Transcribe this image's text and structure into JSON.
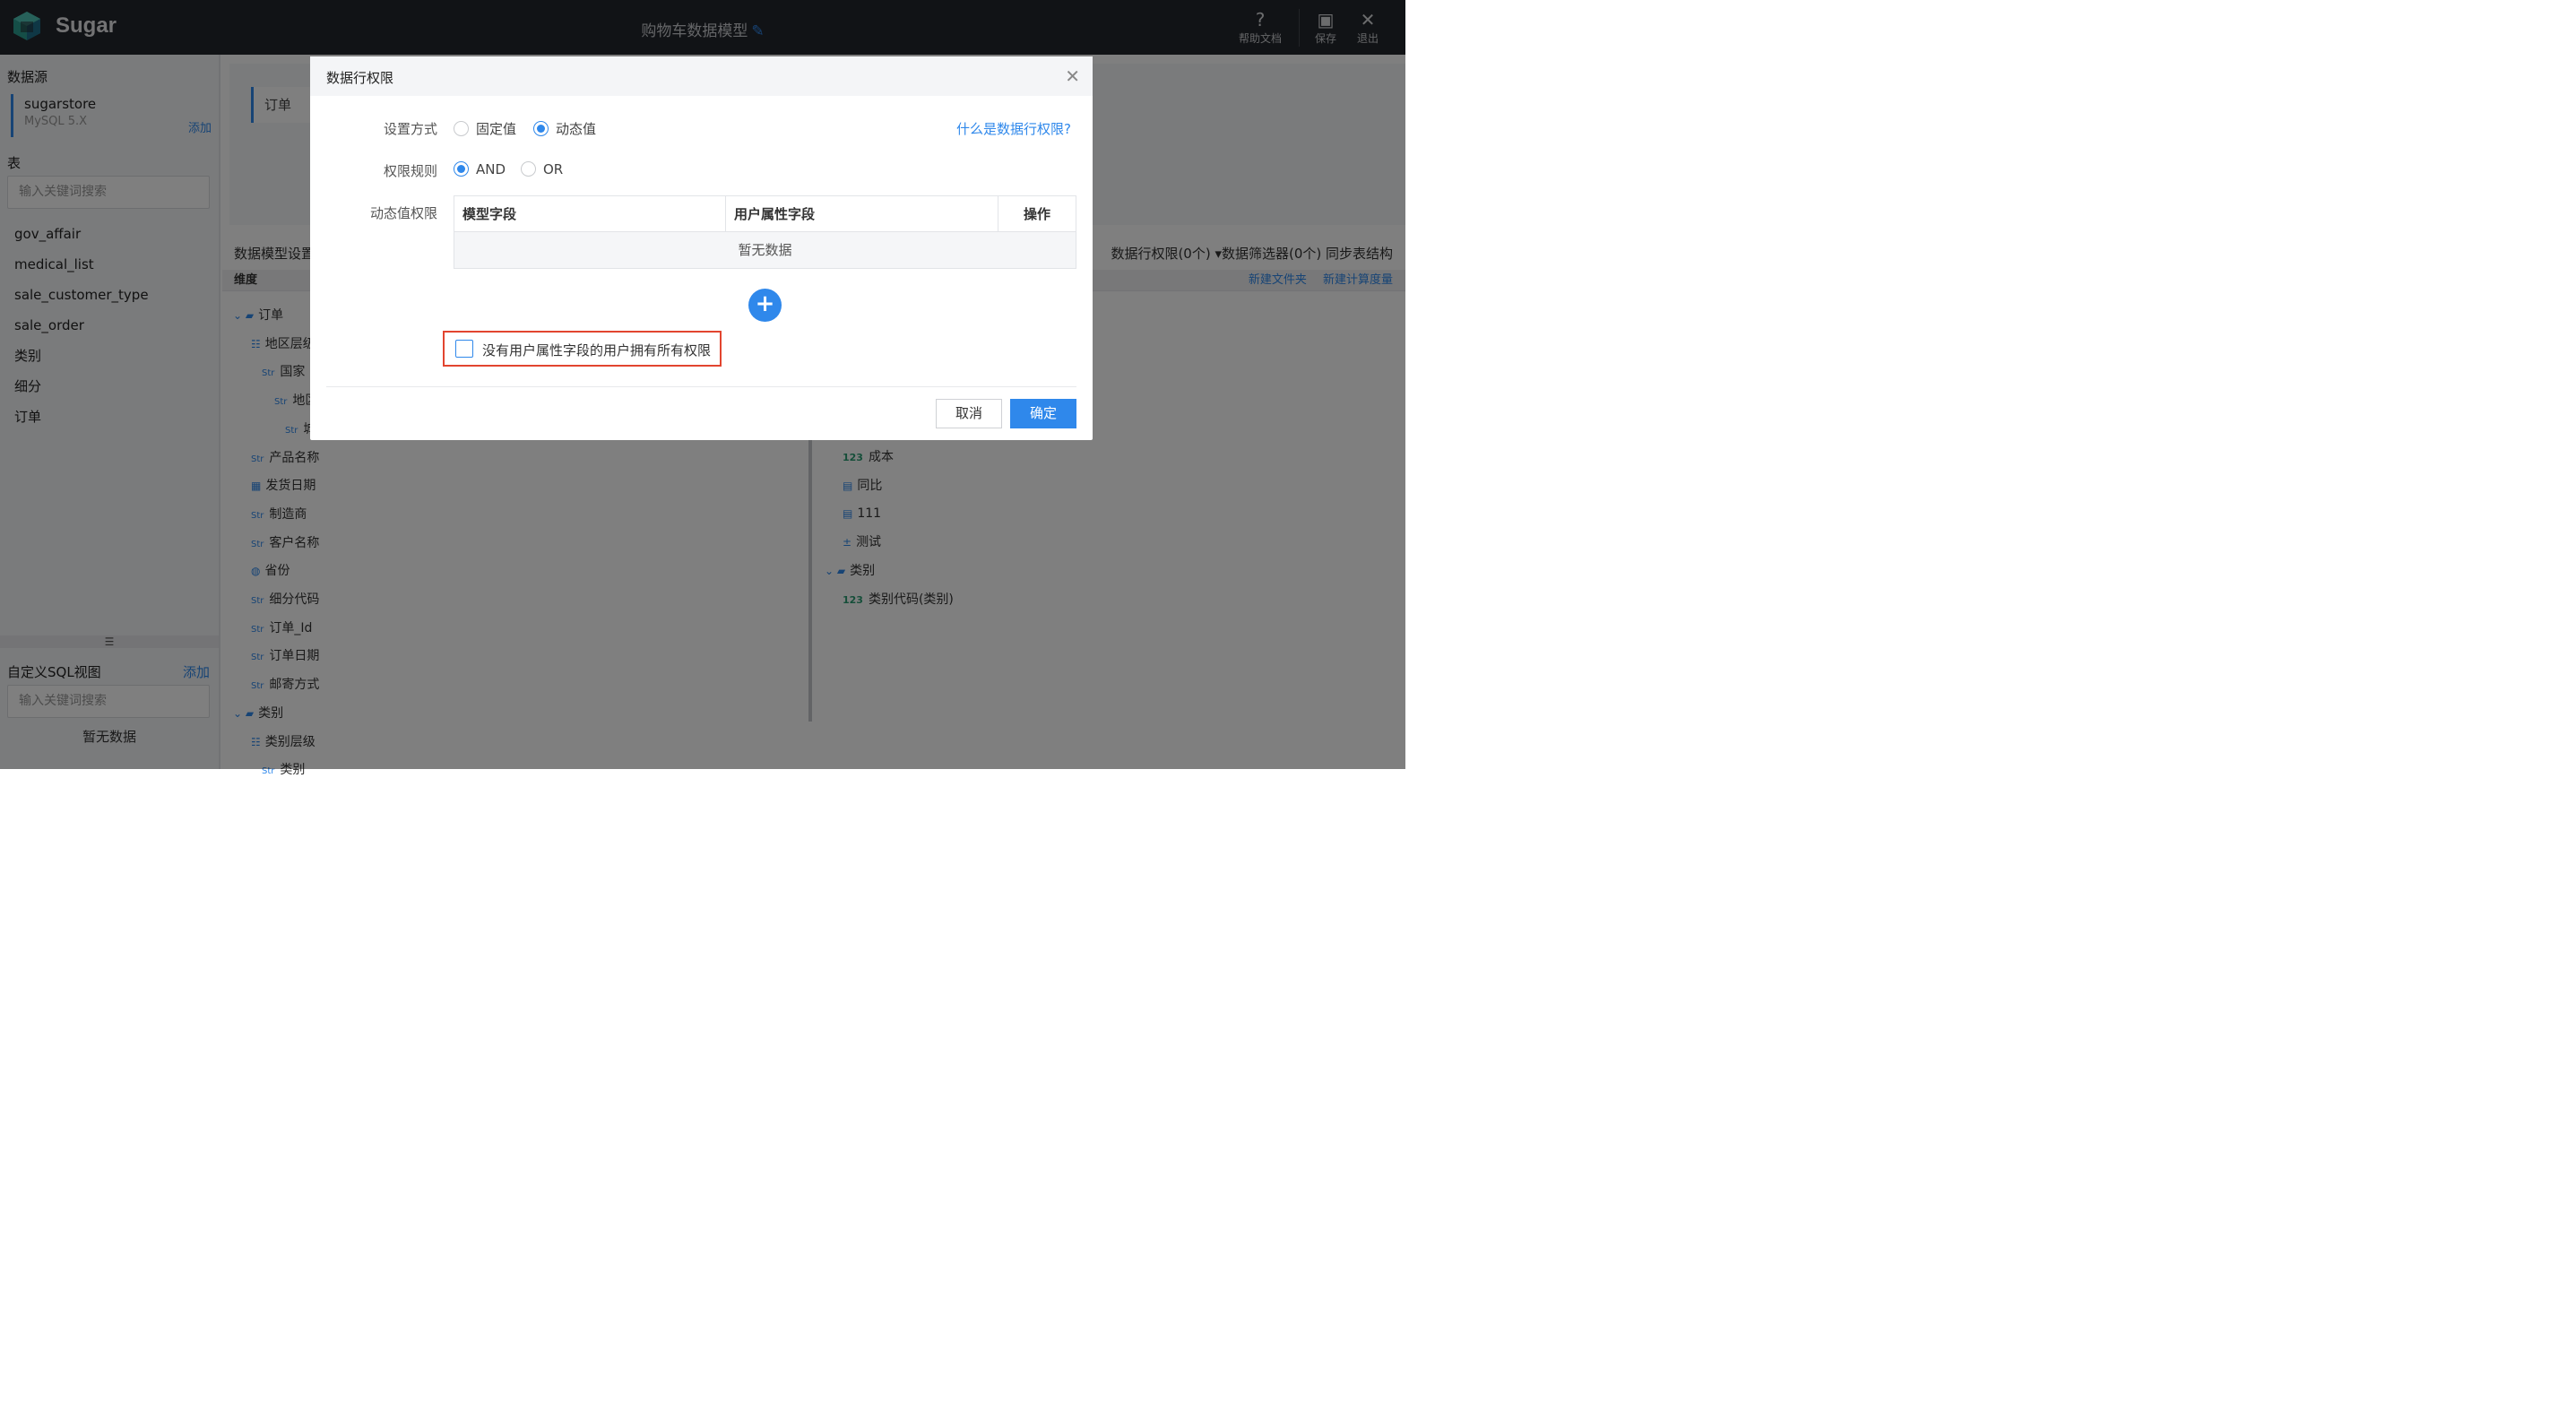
{
  "header": {
    "brand": "Sugar",
    "title": "购物车数据模型",
    "help_label": "帮助文档",
    "save_label": "保存",
    "exit_label": "退出"
  },
  "left": {
    "datasource_title": "数据源",
    "datasource": {
      "name": "sugarstore",
      "type": "MySQL 5.X",
      "add": "添加"
    },
    "table_title": "表",
    "search_placeholder": "输入关键词搜索",
    "tables": [
      "gov_affair",
      "medical_list",
      "sale_customer_type",
      "sale_order",
      "类别",
      "细分",
      "订单"
    ],
    "sql_title": "自定义SQL视图",
    "sql_add": "添加",
    "sql_search_placeholder": "输入关键词搜索",
    "sql_empty": "暂无数据"
  },
  "main": {
    "tab_label": "订单",
    "settings_label": "数据模型设置",
    "right_tools": "数据行权限(0个) ▾数据筛选器(0个)  同步表结构",
    "dim_label": "维度",
    "new_folder": "新建文件夹",
    "new_calc": "新建计算度量",
    "left_tree": [
      {
        "t": "订单",
        "k": "folder"
      },
      {
        "t": "地区层级",
        "k": "hier"
      },
      {
        "t": "国家",
        "k": "str"
      },
      {
        "t": "地区",
        "k": "str"
      },
      {
        "t": "城市",
        "k": "str"
      },
      {
        "t": "产品名称",
        "k": "str"
      },
      {
        "t": "发货日期",
        "k": "date"
      },
      {
        "t": "制造商",
        "k": "str"
      },
      {
        "t": "客户名称",
        "k": "str"
      },
      {
        "t": "省份",
        "k": "geo"
      },
      {
        "t": "细分代码",
        "k": "str"
      },
      {
        "t": "订单_Id",
        "k": "str"
      },
      {
        "t": "订单日期",
        "k": "str"
      },
      {
        "t": "邮寄方式",
        "k": "str"
      },
      {
        "t": "类别",
        "k": "folder"
      },
      {
        "t": "类别层级",
        "k": "hier"
      },
      {
        "t": "类别",
        "k": "str"
      }
    ],
    "right_tree": [
      {
        "t": "成本",
        "k": "num"
      },
      {
        "t": "同比",
        "k": "calc"
      },
      {
        "t": "111",
        "k": "calc"
      },
      {
        "t": "测试",
        "k": "formula"
      },
      {
        "t": "类别",
        "k": "folder"
      },
      {
        "t": "类别代码(类别)",
        "k": "num"
      }
    ]
  },
  "modal": {
    "title": "数据行权限",
    "mode_label": "设置方式",
    "mode_options": [
      "固定值",
      "动态值"
    ],
    "mode_selected": "动态值",
    "help_link": "什么是数据行权限?",
    "rule_label": "权限规则",
    "rule_options": [
      "AND",
      "OR"
    ],
    "rule_selected": "AND",
    "dynamic_label": "动态值权限",
    "columns": [
      "模型字段",
      "用户属性字段",
      "操作"
    ],
    "empty": "暂无数据",
    "checkbox_label": "没有用户属性字段的用户拥有所有权限",
    "cancel": "取消",
    "ok": "确定"
  },
  "colors": {
    "accent": "#2f88eb",
    "highlight": "#e2452f",
    "topbar": "#23262d"
  }
}
